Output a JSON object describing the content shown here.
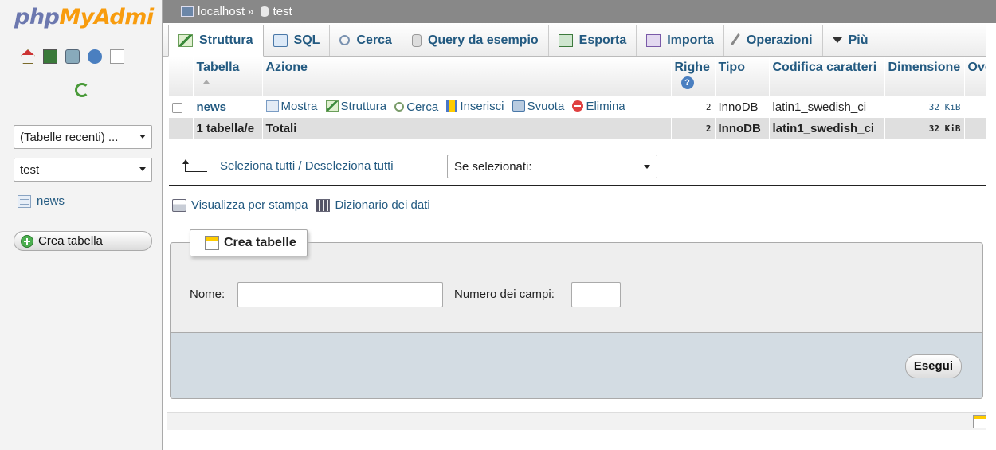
{
  "nav": {
    "logo_php": "php",
    "logo_my": "MyAdmi",
    "recent_select": "(Tabelle recenti) ...",
    "db_select": "test",
    "tables": [
      {
        "label": "news"
      }
    ],
    "create_button": "Crea tabella"
  },
  "breadcrumb": {
    "server": "localhost",
    "separator": "»",
    "database": "test"
  },
  "tabs": [
    {
      "label": "Struttura",
      "icon": "structure-icon"
    },
    {
      "label": "SQL",
      "icon": "sql-icon"
    },
    {
      "label": "Cerca",
      "icon": "search-icon"
    },
    {
      "label": "Query da esempio",
      "icon": "query-icon"
    },
    {
      "label": "Esporta",
      "icon": "export-icon"
    },
    {
      "label": "Importa",
      "icon": "import-icon"
    },
    {
      "label": "Operazioni",
      "icon": "wrench-icon"
    },
    {
      "label": "Più",
      "icon": "chevron-down-icon"
    }
  ],
  "table": {
    "headers": {
      "table": "Tabella",
      "action": "Azione",
      "rows": "Righe",
      "type": "Tipo",
      "collation": "Codifica caratteri",
      "size": "Dimensione",
      "overhead": "Ove"
    },
    "row": {
      "name": "news",
      "actions": {
        "browse": "Mostra",
        "structure": "Struttura",
        "search": "Cerca",
        "insert": "Inserisci",
        "empty": "Svuota",
        "drop": "Elimina"
      },
      "rows": "2",
      "type": "InnoDB",
      "collation": "latin1_swedish_ci",
      "size": "32 KiB"
    },
    "totals": {
      "count": "1 tabella/e",
      "label": "Totali",
      "rows": "2",
      "type": "InnoDB",
      "collation": "latin1_swedish_ci",
      "size": "32 KiB"
    }
  },
  "selection": {
    "check_all": "Seleziona tutti / Deseleziona tutti",
    "with_selected": "Se selezionati:"
  },
  "links": {
    "print": "Visualizza per stampa",
    "dictionary": "Dizionario dei dati"
  },
  "create": {
    "legend": "Crea tabelle",
    "name_label": "Nome:",
    "name_value": "",
    "fields_label": "Numero dei campi:",
    "fields_value": "",
    "go": "Esegui"
  }
}
